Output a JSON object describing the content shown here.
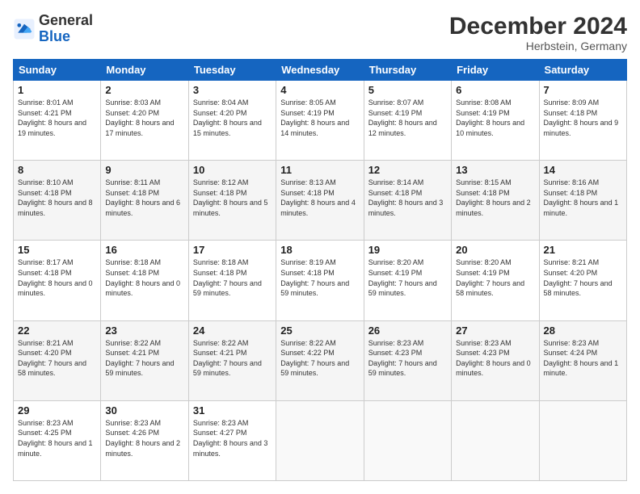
{
  "header": {
    "logo": {
      "general": "General",
      "blue": "Blue"
    },
    "title": "December 2024",
    "location": "Herbstein, Germany"
  },
  "weekdays": [
    "Sunday",
    "Monday",
    "Tuesday",
    "Wednesday",
    "Thursday",
    "Friday",
    "Saturday"
  ],
  "weeks": [
    [
      {
        "day": "1",
        "sunrise": "8:01 AM",
        "sunset": "4:21 PM",
        "daylight": "8 hours and 19 minutes."
      },
      {
        "day": "2",
        "sunrise": "8:03 AM",
        "sunset": "4:20 PM",
        "daylight": "8 hours and 17 minutes."
      },
      {
        "day": "3",
        "sunrise": "8:04 AM",
        "sunset": "4:20 PM",
        "daylight": "8 hours and 15 minutes."
      },
      {
        "day": "4",
        "sunrise": "8:05 AM",
        "sunset": "4:19 PM",
        "daylight": "8 hours and 14 minutes."
      },
      {
        "day": "5",
        "sunrise": "8:07 AM",
        "sunset": "4:19 PM",
        "daylight": "8 hours and 12 minutes."
      },
      {
        "day": "6",
        "sunrise": "8:08 AM",
        "sunset": "4:19 PM",
        "daylight": "8 hours and 10 minutes."
      },
      {
        "day": "7",
        "sunrise": "8:09 AM",
        "sunset": "4:18 PM",
        "daylight": "8 hours and 9 minutes."
      }
    ],
    [
      {
        "day": "8",
        "sunrise": "8:10 AM",
        "sunset": "4:18 PM",
        "daylight": "8 hours and 8 minutes."
      },
      {
        "day": "9",
        "sunrise": "8:11 AM",
        "sunset": "4:18 PM",
        "daylight": "8 hours and 6 minutes."
      },
      {
        "day": "10",
        "sunrise": "8:12 AM",
        "sunset": "4:18 PM",
        "daylight": "8 hours and 5 minutes."
      },
      {
        "day": "11",
        "sunrise": "8:13 AM",
        "sunset": "4:18 PM",
        "daylight": "8 hours and 4 minutes."
      },
      {
        "day": "12",
        "sunrise": "8:14 AM",
        "sunset": "4:18 PM",
        "daylight": "8 hours and 3 minutes."
      },
      {
        "day": "13",
        "sunrise": "8:15 AM",
        "sunset": "4:18 PM",
        "daylight": "8 hours and 2 minutes."
      },
      {
        "day": "14",
        "sunrise": "8:16 AM",
        "sunset": "4:18 PM",
        "daylight": "8 hours and 1 minute."
      }
    ],
    [
      {
        "day": "15",
        "sunrise": "8:17 AM",
        "sunset": "4:18 PM",
        "daylight": "8 hours and 0 minutes."
      },
      {
        "day": "16",
        "sunrise": "8:18 AM",
        "sunset": "4:18 PM",
        "daylight": "8 hours and 0 minutes."
      },
      {
        "day": "17",
        "sunrise": "8:18 AM",
        "sunset": "4:18 PM",
        "daylight": "7 hours and 59 minutes."
      },
      {
        "day": "18",
        "sunrise": "8:19 AM",
        "sunset": "4:18 PM",
        "daylight": "7 hours and 59 minutes."
      },
      {
        "day": "19",
        "sunrise": "8:20 AM",
        "sunset": "4:19 PM",
        "daylight": "7 hours and 59 minutes."
      },
      {
        "day": "20",
        "sunrise": "8:20 AM",
        "sunset": "4:19 PM",
        "daylight": "7 hours and 58 minutes."
      },
      {
        "day": "21",
        "sunrise": "8:21 AM",
        "sunset": "4:20 PM",
        "daylight": "7 hours and 58 minutes."
      }
    ],
    [
      {
        "day": "22",
        "sunrise": "8:21 AM",
        "sunset": "4:20 PM",
        "daylight": "7 hours and 58 minutes."
      },
      {
        "day": "23",
        "sunrise": "8:22 AM",
        "sunset": "4:21 PM",
        "daylight": "7 hours and 59 minutes."
      },
      {
        "day": "24",
        "sunrise": "8:22 AM",
        "sunset": "4:21 PM",
        "daylight": "7 hours and 59 minutes."
      },
      {
        "day": "25",
        "sunrise": "8:22 AM",
        "sunset": "4:22 PM",
        "daylight": "7 hours and 59 minutes."
      },
      {
        "day": "26",
        "sunrise": "8:23 AM",
        "sunset": "4:23 PM",
        "daylight": "7 hours and 59 minutes."
      },
      {
        "day": "27",
        "sunrise": "8:23 AM",
        "sunset": "4:23 PM",
        "daylight": "8 hours and 0 minutes."
      },
      {
        "day": "28",
        "sunrise": "8:23 AM",
        "sunset": "4:24 PM",
        "daylight": "8 hours and 1 minute."
      }
    ],
    [
      {
        "day": "29",
        "sunrise": "8:23 AM",
        "sunset": "4:25 PM",
        "daylight": "8 hours and 1 minute."
      },
      {
        "day": "30",
        "sunrise": "8:23 AM",
        "sunset": "4:26 PM",
        "daylight": "8 hours and 2 minutes."
      },
      {
        "day": "31",
        "sunrise": "8:23 AM",
        "sunset": "4:27 PM",
        "daylight": "8 hours and 3 minutes."
      },
      null,
      null,
      null,
      null
    ]
  ],
  "labels": {
    "sunrise": "Sunrise:",
    "sunset": "Sunset:",
    "daylight": "Daylight:"
  }
}
